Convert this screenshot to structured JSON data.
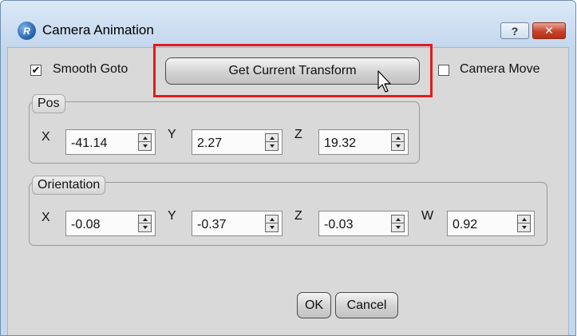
{
  "window": {
    "title": "Camera Animation",
    "app_icon": "app-logo-icon",
    "help_glyph": "?",
    "close_glyph": "✕"
  },
  "smooth_goto": {
    "label": "Smooth Goto",
    "checked": true,
    "glyph": "✔"
  },
  "get_transform_button": {
    "label": "Get Current Transform"
  },
  "camera_move": {
    "label": "Camera Move",
    "checked": false
  },
  "pos": {
    "title": "Pos",
    "fields": [
      {
        "axis": "X",
        "value": "-41.14"
      },
      {
        "axis": "Y",
        "value": "2.27"
      },
      {
        "axis": "Z",
        "value": "19.32"
      }
    ]
  },
  "orientation": {
    "title": "Orientation",
    "fields": [
      {
        "axis": "X",
        "value": "-0.08"
      },
      {
        "axis": "Y",
        "value": "-0.37"
      },
      {
        "axis": "Z",
        "value": "-0.03"
      },
      {
        "axis": "W",
        "value": "0.92"
      }
    ]
  },
  "buttons": {
    "ok": "OK",
    "cancel": "Cancel"
  },
  "colors": {
    "highlight": "#e21b1b",
    "close": "#c8412b"
  }
}
